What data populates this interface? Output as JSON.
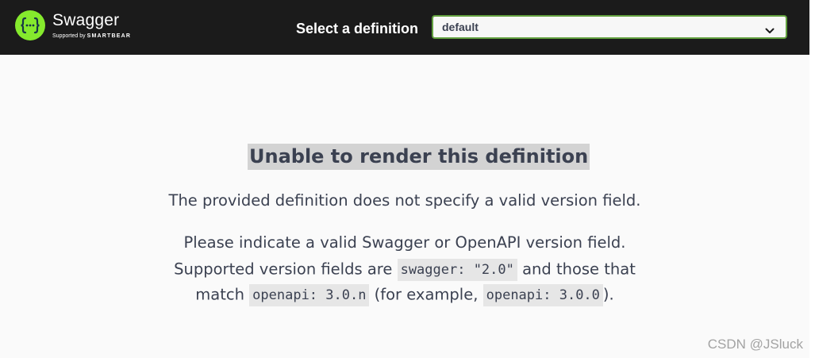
{
  "header": {
    "brand": "Swagger",
    "supported_by": "Supported by",
    "supported_brand": "SMARTBEAR",
    "select_label": "Select a definition",
    "select_value": "default",
    "logo_icon": "swagger-braces-icon",
    "chevron_icon": "chevron-down-icon"
  },
  "error": {
    "title": "Unable to render this definition",
    "line1": "The provided definition does not specify a valid version field.",
    "line2": "Please indicate a valid Swagger or OpenAPI version field.",
    "line3_pre": "Supported version fields are ",
    "line3_code": "swagger: \"2.0\"",
    "line3_post": " and those that",
    "line4_pre": "match ",
    "line4_code1": "openapi: 3.0.n",
    "line4_mid": " (for example, ",
    "line4_code2": "openapi: 3.0.0",
    "line4_post": ")."
  },
  "watermark": "CSDN @JSluck",
  "colors": {
    "topbar": "#1b1b1b",
    "logo_green": "#85ea2d",
    "select_border": "#62a03f",
    "text": "#3b4151",
    "code_bg": "#e6e6e6",
    "title_highlight": "#d3d3d3"
  }
}
